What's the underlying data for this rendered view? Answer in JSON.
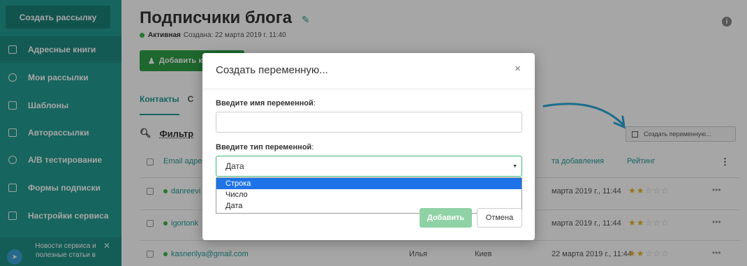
{
  "sidebar": {
    "create_button": "Создать рассылку",
    "items": [
      {
        "label": "Адресные книги",
        "icon": "book-icon"
      },
      {
        "label": "Мои рассылки",
        "icon": "mail-icon"
      },
      {
        "label": "Шаблоны",
        "icon": "template-icon"
      },
      {
        "label": "Авторассылки",
        "icon": "automation-icon"
      },
      {
        "label": "A/B тестирование",
        "icon": "ab-test-icon"
      },
      {
        "label": "Формы подписки",
        "icon": "form-icon"
      },
      {
        "label": "Настройки сервиса",
        "icon": "settings-icon"
      }
    ],
    "promo": {
      "text": "Новости сервиса и полезные статьи в",
      "close": "✕",
      "icon": "telegram-icon"
    }
  },
  "header": {
    "title": "Подписчики блога",
    "status": "Активная",
    "created": "Создана: 22 марта 2019 г. 11:40",
    "add_button": "Добавить к",
    "info": "i"
  },
  "tabs": [
    {
      "label": "Контакты"
    },
    {
      "label": "С"
    }
  ],
  "filter": {
    "label": "Фильтр",
    "icon": "search-icon"
  },
  "create_variable_button": "Создать переменную...",
  "table": {
    "headers": {
      "email": "Email адре",
      "date": "та добавления",
      "rating": "Рейтинг",
      "menu": "⋮"
    },
    "rows": [
      {
        "email": "danreevi",
        "name": "",
        "city": "",
        "date": "марта 2019 г., 11:44",
        "stars": 2
      },
      {
        "email": "igortonk",
        "name": "",
        "city": "",
        "date": "марта 2019 г., 11:44",
        "stars": 2
      },
      {
        "email": "kasnerilya@gmail.com",
        "name": "Илья",
        "city": "Киев",
        "date": "22 марта 2019 г., 11:44",
        "stars": 2
      }
    ],
    "row_menu": "•••"
  },
  "modal": {
    "title": "Создать переменную...",
    "close": "×",
    "name_label": "Введите имя переменной",
    "name_value": "",
    "type_label": "Введите тип переменной",
    "selected_type": "Дата",
    "options": [
      "Строка",
      "Число",
      "Дата"
    ],
    "highlighted_option": "Строка",
    "add_button": "Добавить",
    "cancel_button": "Отмена"
  },
  "colors": {
    "sidebar": "#229b91",
    "accent": "#229b91",
    "green": "#2e9e47",
    "highlight": "#1e73e8"
  }
}
